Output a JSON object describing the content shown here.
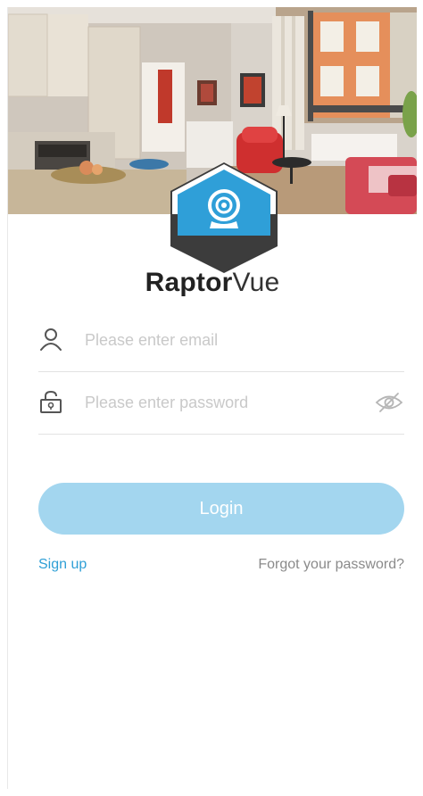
{
  "brand": {
    "name_bold": "Raptor",
    "name_light": "Vue"
  },
  "login_form": {
    "email_placeholder": "Please enter email",
    "password_placeholder": "Please enter password",
    "login_label": "Login",
    "signup_label": "Sign up",
    "forgot_label": "Forgot your password?"
  },
  "icons": {
    "email": "user-icon",
    "password": "lock-icon",
    "toggle_visibility": "eye-off-icon",
    "logo": "webcam-icon"
  },
  "colors": {
    "accent": "#2e9fd6",
    "login_button": "#a3d6ef",
    "logo_blue": "#2f9fd8",
    "logo_dark": "#3c3c3c"
  }
}
